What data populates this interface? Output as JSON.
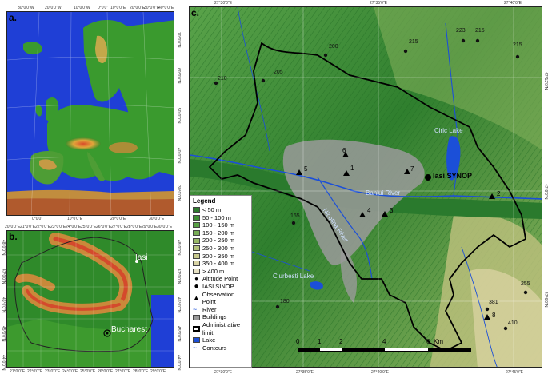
{
  "panels": {
    "a": {
      "label": "a."
    },
    "b": {
      "label": "b."
    },
    "c": {
      "label": "c."
    }
  },
  "panel_a": {
    "top_ticks": [
      "30°0'0\"W",
      "20°0'0\"W",
      "10°0'0\"W",
      "0°0'0\"",
      "10°0'0\"E",
      "20°0'0\"E",
      "30°0'0\"E",
      "40°0'0\"E"
    ],
    "bottom_ticks": [
      "0°0'0\"",
      "10°0'0\"E",
      "20°0'0\"E",
      "30°0'0\"E"
    ],
    "right_ticks": [
      "70°0'0\"N",
      "60°0'0\"N",
      "50°0'0\"N",
      "40°0'0\"N",
      "30°0'0\"N"
    ]
  },
  "panel_b": {
    "top_ticks": [
      "20°0'0\"E",
      "21°0'0\"E",
      "22°0'0\"E",
      "23°0'0\"E",
      "24°0'0\"E",
      "25°0'0\"E",
      "26°0'0\"E",
      "27°0'0\"E",
      "28°0'0\"E",
      "29°0'0\"E",
      "30°0'0\"E"
    ],
    "bottom_ticks": [
      "21°0'0\"E",
      "22°0'0\"E",
      "23°0'0\"E",
      "24°0'0\"E",
      "25°0'0\"E",
      "26°0'0\"E",
      "27°0'0\"E",
      "28°0'0\"E",
      "29°0'0\"E"
    ],
    "left_ticks": [
      "48°0'0\"N",
      "47°0'0\"N",
      "46°0'0\"N",
      "45°0'0\"N",
      "44°0'0\"N"
    ],
    "right_ticks": [
      "48°0'0\"N",
      "47°0'0\"N",
      "46°0'0\"N",
      "45°0'0\"N",
      "44°0'0\"N"
    ],
    "cities": [
      {
        "name": "Iasi"
      },
      {
        "name": "Bucharest"
      }
    ]
  },
  "panel_c": {
    "top_ticks": [
      "27°30'0\"E",
      "27°35'0\"E",
      "27°40'0\"E"
    ],
    "bottom_ticks": [
      "27°30'0\"E",
      "27°35'0\"E",
      "27°40'0\"E",
      "27°45'0\"E"
    ],
    "right_ticks": [
      "47°12'0\"N",
      "47°9'0\"N",
      "47°6'0\"N"
    ],
    "water_labels": {
      "lake1": "Ciric Lake",
      "lake2": "Ciurbesti Lake",
      "river": "Bahlui River",
      "river2": "Nicolina River"
    },
    "synop_label": "Iasi SYNOP",
    "altitude_points": [
      "210",
      "205",
      "200",
      "215",
      "223",
      "215",
      "215",
      "165",
      "180",
      "255",
      "381",
      "410"
    ],
    "observation_points": [
      "1",
      "2",
      "3",
      "4",
      "5",
      "6",
      "7",
      "8"
    ],
    "scale": {
      "ticks": [
        "0",
        "1",
        "2",
        "4",
        "6"
      ],
      "unit": "Km"
    }
  },
  "legend": {
    "title": "Legend",
    "classes": [
      {
        "label": "< 50 m",
        "color": "#2e7d2e"
      },
      {
        "label": "50 - 100 m",
        "color": "#3f8f35"
      },
      {
        "label": "100 - 150 m",
        "color": "#58a045"
      },
      {
        "label": "150 - 200 m",
        "color": "#78ad55"
      },
      {
        "label": "200 - 250 m",
        "color": "#98b866"
      },
      {
        "label": "250 - 300 m",
        "color": "#b3c27a"
      },
      {
        "label": "300 - 350 m",
        "color": "#c8c98d"
      },
      {
        "label": "350 - 400 m",
        "color": "#d9d4a4"
      },
      {
        "label": "> 400 m",
        "color": "#e8e2c4"
      }
    ],
    "symbols": [
      {
        "label": "Altitude Point"
      },
      {
        "label": "IASI SINOP"
      },
      {
        "label": "Observation Point"
      },
      {
        "label": "River"
      },
      {
        "label": "Buildings"
      },
      {
        "label": "Administrative limit"
      },
      {
        "label": "Lake"
      },
      {
        "label": "Contours"
      }
    ]
  }
}
